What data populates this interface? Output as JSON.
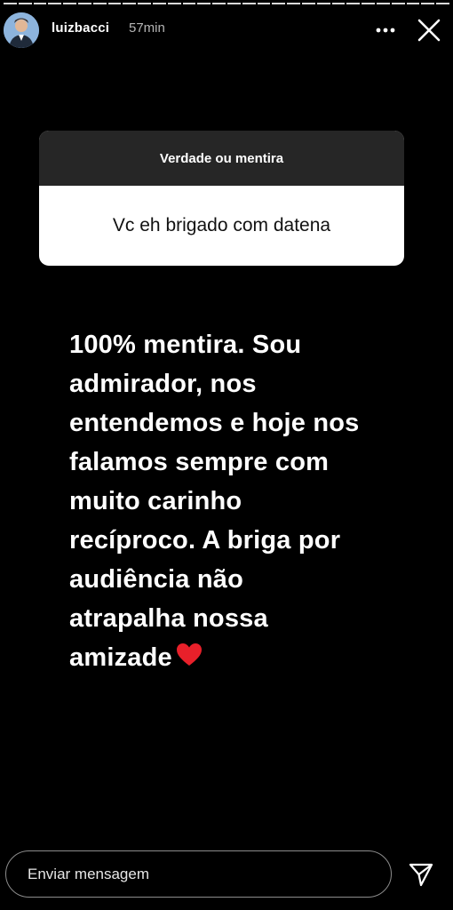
{
  "story": {
    "progress_segments": 30,
    "username": "luizbacci",
    "time": "57min",
    "icons": {
      "avatar": "profile-avatar",
      "more": "more-options-icon",
      "close": "close-icon",
      "send": "send-icon",
      "heart": "red-heart-emoji"
    }
  },
  "question": {
    "title": "Verdade ou mentira",
    "text": "Vc eh brigado com datena"
  },
  "answer": {
    "lines": [
      "100% mentira. Sou",
      "admirador, nos",
      "entendemos e hoje nos",
      "falamos sempre com",
      "muito carinho",
      "recíproco. A briga por",
      "audiência não",
      "atrapalha nossa",
      "amizade"
    ]
  },
  "reply": {
    "placeholder": "Enviar mensagem"
  },
  "colors": {
    "background": "#000000",
    "question_header": "#262626",
    "heart": "#e8202a"
  }
}
